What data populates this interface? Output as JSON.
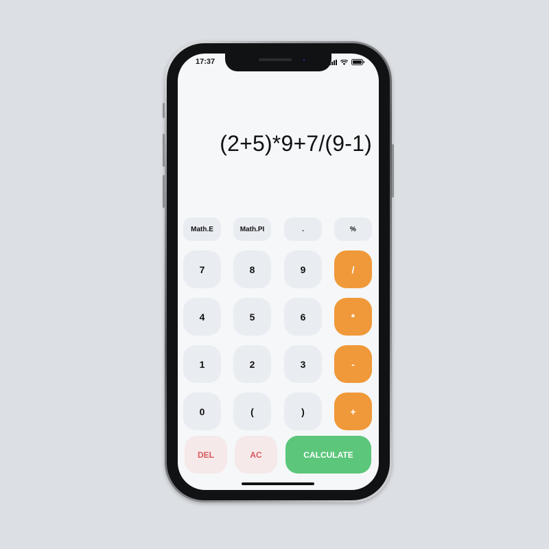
{
  "status_bar": {
    "time": "17:37"
  },
  "display": {
    "expression": "(2+5)*9+7/(9-1)"
  },
  "colors": {
    "background": "#dcdfe3",
    "screen": "#f5f7f9",
    "key": "#e9edf1",
    "operator": "#f0993a",
    "delete_bg": "#f6e9ea",
    "delete_text": "#d9585d",
    "calculate": "#5cc67b"
  },
  "keys": {
    "math_e": "Math.E",
    "math_pi": "Math.PI",
    "dot": ".",
    "percent": "%",
    "seven": "7",
    "eight": "8",
    "nine": "9",
    "divide": "/",
    "four": "4",
    "five": "5",
    "six": "6",
    "multiply": "*",
    "one": "1",
    "two": "2",
    "three": "3",
    "minus": "-",
    "zero": "0",
    "open_paren": "(",
    "close_paren": ")",
    "plus": "+",
    "del": "DEL",
    "ac": "AC",
    "calculate": "CALCULATE"
  }
}
